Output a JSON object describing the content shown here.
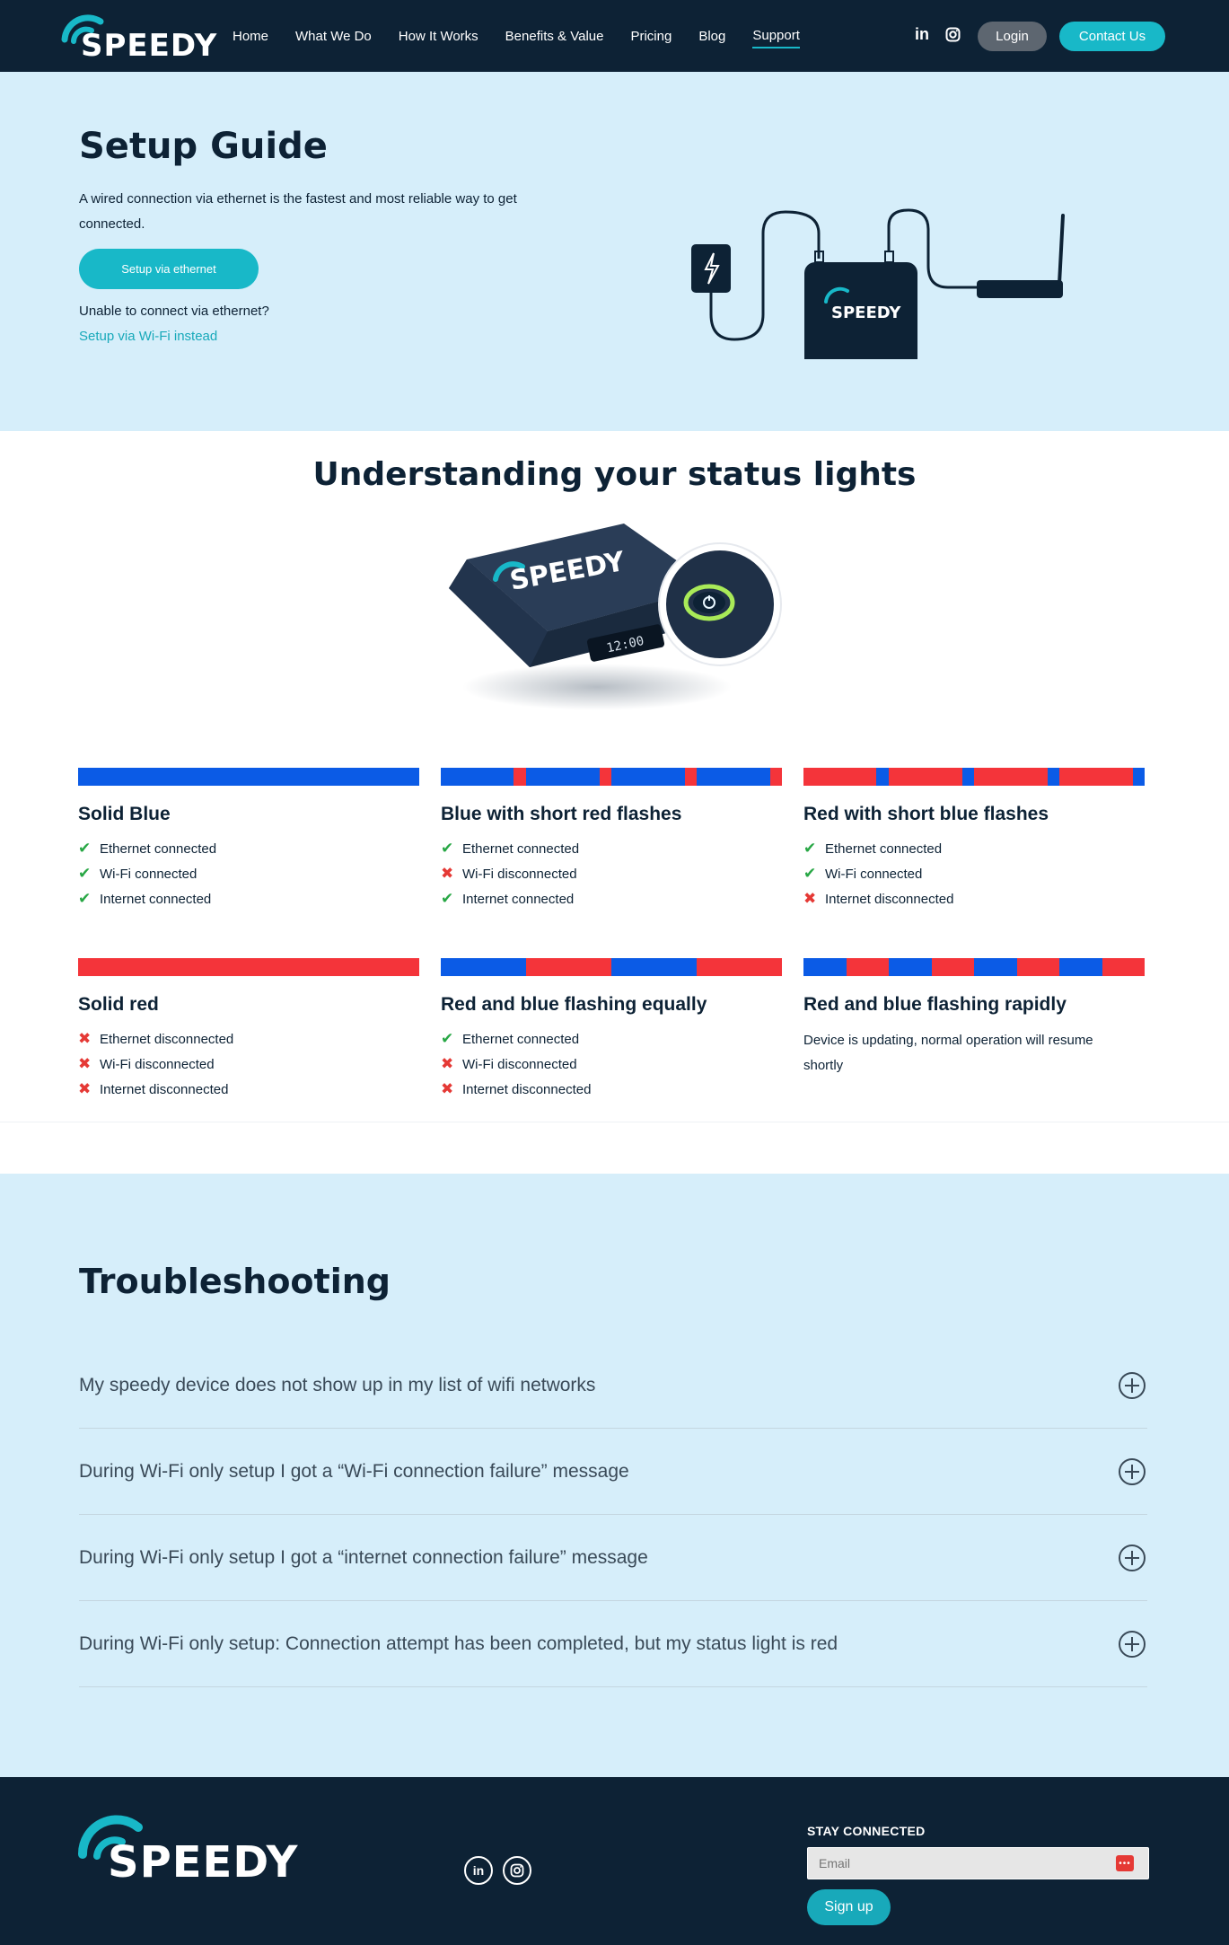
{
  "header": {
    "brand": "SPEEDY",
    "nav": [
      "Home",
      "What We Do",
      "How It Works",
      "Benefits & Value",
      "Pricing",
      "Blog",
      "Support"
    ],
    "active_nav": "Support",
    "social_linkedin": "in",
    "login_label": "Login",
    "contact_label": "Contact Us"
  },
  "setup": {
    "title": "Setup Guide",
    "description": "A wired connection via ethernet is the fastest and most reliable way to get connected.",
    "button_label": "Setup via ethernet",
    "alt_question": "Unable to connect via ethernet?",
    "alt_link": "Setup via Wi-Fi instead",
    "device_brand": "SPEEDY"
  },
  "status": {
    "title": "Understanding your status lights",
    "device_brand": "SPEEDY",
    "device_clock": "12:00",
    "colors": {
      "blue": "#0b5be6",
      "red": "#f4343a",
      "ok": "#28a745",
      "bad": "#e53935"
    },
    "cards": [
      {
        "title": "Solid Blue",
        "pattern": [
          "blue"
        ],
        "items": [
          {
            "label": "Ethernet connected",
            "ok": true
          },
          {
            "label": "Wi-Fi connected",
            "ok": true
          },
          {
            "label": "Internet connected",
            "ok": true
          }
        ]
      },
      {
        "title": "Blue with short red flashes",
        "pattern": [
          "blue",
          "blue",
          "blue",
          "blue",
          "blue",
          "blue",
          "red",
          "blue",
          "blue",
          "blue",
          "blue",
          "blue",
          "blue",
          "red",
          "blue",
          "blue",
          "blue",
          "blue",
          "blue",
          "blue",
          "red",
          "blue",
          "blue",
          "blue",
          "blue",
          "blue",
          "blue",
          "red"
        ],
        "items": [
          {
            "label": "Ethernet connected",
            "ok": true
          },
          {
            "label": "Wi-Fi disconnected",
            "ok": false
          },
          {
            "label": "Internet connected",
            "ok": true
          }
        ]
      },
      {
        "title": "Red with short blue flashes",
        "pattern": [
          "red",
          "red",
          "red",
          "red",
          "red",
          "red",
          "blue",
          "red",
          "red",
          "red",
          "red",
          "red",
          "red",
          "blue",
          "red",
          "red",
          "red",
          "red",
          "red",
          "red",
          "blue",
          "red",
          "red",
          "red",
          "red",
          "red",
          "red",
          "blue"
        ],
        "items": [
          {
            "label": "Ethernet connected",
            "ok": true
          },
          {
            "label": "Wi-Fi connected",
            "ok": true
          },
          {
            "label": "Internet disconnected",
            "ok": false
          }
        ]
      },
      {
        "title": "Solid red",
        "pattern": [
          "red"
        ],
        "items": [
          {
            "label": "Ethernet disconnected",
            "ok": false
          },
          {
            "label": "Wi-Fi disconnected",
            "ok": false
          },
          {
            "label": "Internet disconnected",
            "ok": false
          }
        ]
      },
      {
        "title": "Red and blue flashing equally",
        "pattern": [
          "blue",
          "red",
          "blue",
          "red"
        ],
        "items": [
          {
            "label": "Ethernet connected",
            "ok": true
          },
          {
            "label": "Wi-Fi disconnected",
            "ok": false
          },
          {
            "label": "Internet disconnected",
            "ok": false
          }
        ]
      },
      {
        "title": "Red and blue flashing rapidly",
        "pattern": [
          "blue",
          "red",
          "blue",
          "red",
          "blue",
          "red",
          "blue",
          "red"
        ],
        "note": "Device is updating, normal operation will resume shortly",
        "items": []
      }
    ]
  },
  "troubleshooting": {
    "title": "Troubleshooting",
    "questions": [
      "My speedy device does not show up in my list of wifi networks",
      "During Wi-Fi only setup I got a “Wi-Fi connection failure” message",
      "During Wi-Fi only setup I got a “internet connection failure” message",
      "During Wi-Fi only setup: Connection attempt has been completed, but my status light is red"
    ]
  },
  "footer": {
    "brand": "SPEEDY",
    "linkedin": "in",
    "stay_connected": "STAY CONNECTED",
    "email_placeholder": "Email",
    "signup_label": "Sign up"
  }
}
